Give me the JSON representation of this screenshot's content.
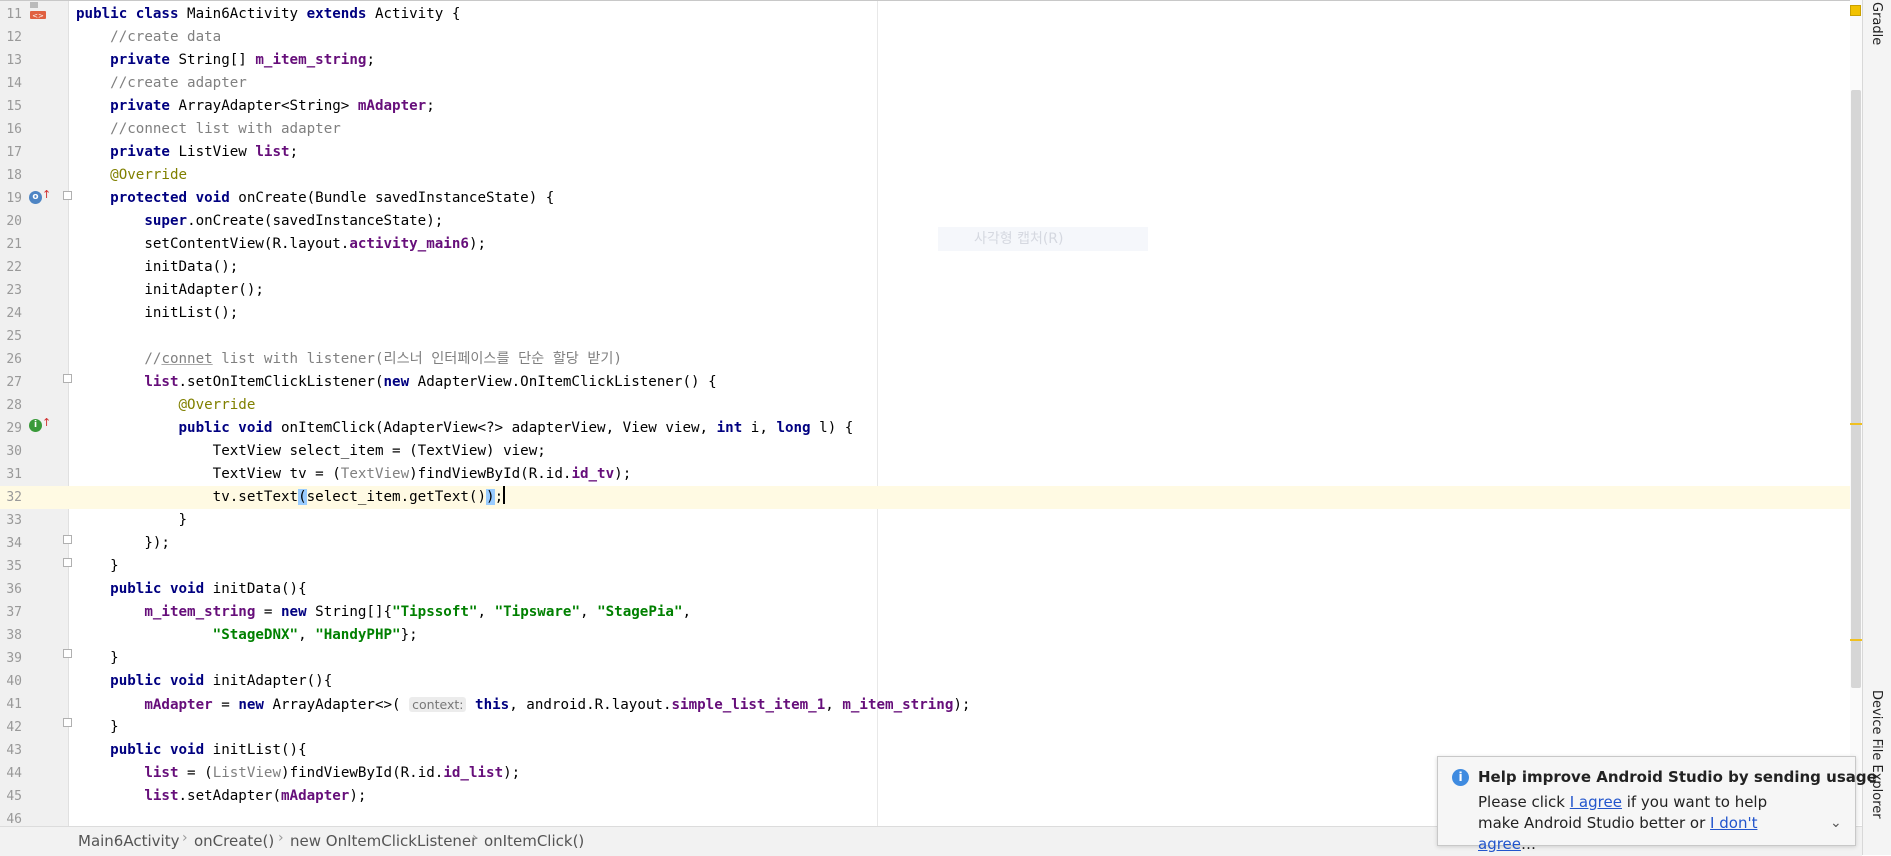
{
  "editor": {
    "gutter_icons": {
      "class_icon": "class-run-icon",
      "override_marker": "override-method-icon"
    },
    "ghost_text": "사각형 캡처(R)",
    "lines": [
      {
        "n": "11",
        "code": "<span class='kw'>public class</span> Main6Activity <span class='kw'>extends</span> Activity {"
      },
      {
        "n": "12",
        "code": "    <span class='cm'>//create data</span>"
      },
      {
        "n": "13",
        "code": "    <span class='kw'>private</span> String[] <span class='fd'>m_item_string</span>;"
      },
      {
        "n": "14",
        "code": "    <span class='cm'>//create adapter</span>"
      },
      {
        "n": "15",
        "code": "    <span class='kw'>private</span> ArrayAdapter&lt;String&gt; <span class='fd'>mAdapter</span>;"
      },
      {
        "n": "16",
        "code": "    <span class='cm'>//connect list with adapter</span>"
      },
      {
        "n": "17",
        "code": "    <span class='kw'>private</span> ListView <span class='fd'>list</span>;"
      },
      {
        "n": "18",
        "code": "    <span class='an'>@Override</span>"
      },
      {
        "n": "19",
        "code": "    <span class='kw'>protected void</span> onCreate(Bundle savedInstanceState) {"
      },
      {
        "n": "20",
        "code": "        <span class='kw'>super</span>.onCreate(savedInstanceState);"
      },
      {
        "n": "21",
        "code": "        setContentView(R.layout.<span class='fd'>activity_main6</span>);"
      },
      {
        "n": "22",
        "code": "        initData();"
      },
      {
        "n": "23",
        "code": "        initAdapter();"
      },
      {
        "n": "24",
        "code": "        initList();"
      },
      {
        "n": "25",
        "code": ""
      },
      {
        "n": "26",
        "code": "        <span class='cm'>//<span class='ul'>connet</span> list with listener(리스너 인터페이스를 단순 할당 받기)</span>"
      },
      {
        "n": "27",
        "code": "        <span class='fd'>list</span>.setOnItemClickListener(<span class='kw'>new</span> AdapterView.OnItemClickListener() {"
      },
      {
        "n": "28",
        "code": "            <span class='an'>@Override</span>"
      },
      {
        "n": "29",
        "code": "            <span class='kw'>public void</span> onItemClick(AdapterView&lt;?&gt; adapterView, View view, <span class='kw'>int</span> i, <span class='kw'>long</span> l) {"
      },
      {
        "n": "30",
        "code": "                TextView select_item = (TextView) view;"
      },
      {
        "n": "31",
        "code": "                TextView tv = (<span class='cm'>TextView</span>)findViewById(R.id.<span class='fd'>id_tv</span>);"
      },
      {
        "n": "32",
        "code": "                tv.setText<span class='match'>(</span>select_item.getText()<span class='match'>)</span>;<span class='caret'></span>",
        "current": true
      },
      {
        "n": "33",
        "code": "            }"
      },
      {
        "n": "34",
        "code": "        });"
      },
      {
        "n": "35",
        "code": "    }"
      },
      {
        "n": "36",
        "code": "    <span class='kw'>public void</span> initData(){"
      },
      {
        "n": "37",
        "code": "        <span class='fd'>m_item_string</span> = <span class='kw'>new</span> String[]{<span class='st'>\"Tipssoft\"</span>, <span class='st'>\"Tipsware\"</span>, <span class='st'>\"StagePia\"</span>,"
      },
      {
        "n": "38",
        "code": "                <span class='st'>\"StageDNX\"</span>, <span class='st'>\"HandyPHP\"</span>};"
      },
      {
        "n": "39",
        "code": "    }"
      },
      {
        "n": "40",
        "code": "    <span class='kw'>public void</span> initAdapter(){"
      },
      {
        "n": "41",
        "code": "        <span class='fd'>mAdapter</span> = <span class='kw'>new</span> ArrayAdapter&lt;&gt;( <span class='hint'>context:</span> <span class='kw'>this</span>, android.R.layout.<span class='fd'>simple_list_item_1</span>, <span class='fd'>m_item_string</span>);"
      },
      {
        "n": "42",
        "code": "    }"
      },
      {
        "n": "43",
        "code": "    <span class='kw'>public void</span> initList(){"
      },
      {
        "n": "44",
        "code": "        <span class='fd'>list</span> = (<span class='cm'>ListView</span>)findViewById(R.id.<span class='fd'>id_list</span>);"
      },
      {
        "n": "45",
        "code": "        <span class='fd'>list</span>.setAdapter(<span class='fd'>mAdapter</span>);"
      },
      {
        "n": "46",
        "code": ""
      }
    ]
  },
  "right_tabs": {
    "top": "Gradle",
    "bottom": "Device File Explorer"
  },
  "breadcrumb": [
    "Main6Activity",
    "onCreate()",
    "new OnItemClickListener",
    "onItemClick()"
  ],
  "notification": {
    "icon": "info-icon",
    "title": "Help improve Android Studio by sending usage",
    "body_prefix": "Please click ",
    "agree_link": "I agree",
    "body_middle": " if you want to help make Android Studio better or ",
    "disagree_link": "I don't agree",
    "body_suffix": "…",
    "chevron": "⌄"
  },
  "colors": {
    "keyword": "#000080",
    "comment": "#808080",
    "annotation": "#808000",
    "field": "#660e7a",
    "string": "#008000",
    "current_line": "#fffae3",
    "link": "#2255cc"
  }
}
